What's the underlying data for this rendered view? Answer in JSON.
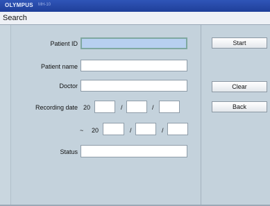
{
  "titlebar": {
    "brand": "OLYMPUS",
    "model": "MH-10"
  },
  "header": {
    "title": "Search"
  },
  "form": {
    "patient_id_label": "Patient ID",
    "patient_id_value": "",
    "patient_name_label": "Patient name",
    "patient_name_value": "",
    "doctor_label": "Doctor",
    "doctor_value": "",
    "recording_date_label": "Recording date",
    "century_prefix": "20",
    "date_separator": "/",
    "range_tilde": "~",
    "status_label": "Status",
    "status_value": ""
  },
  "buttons": {
    "start": "Start",
    "clear": "Clear",
    "back": "Back"
  }
}
